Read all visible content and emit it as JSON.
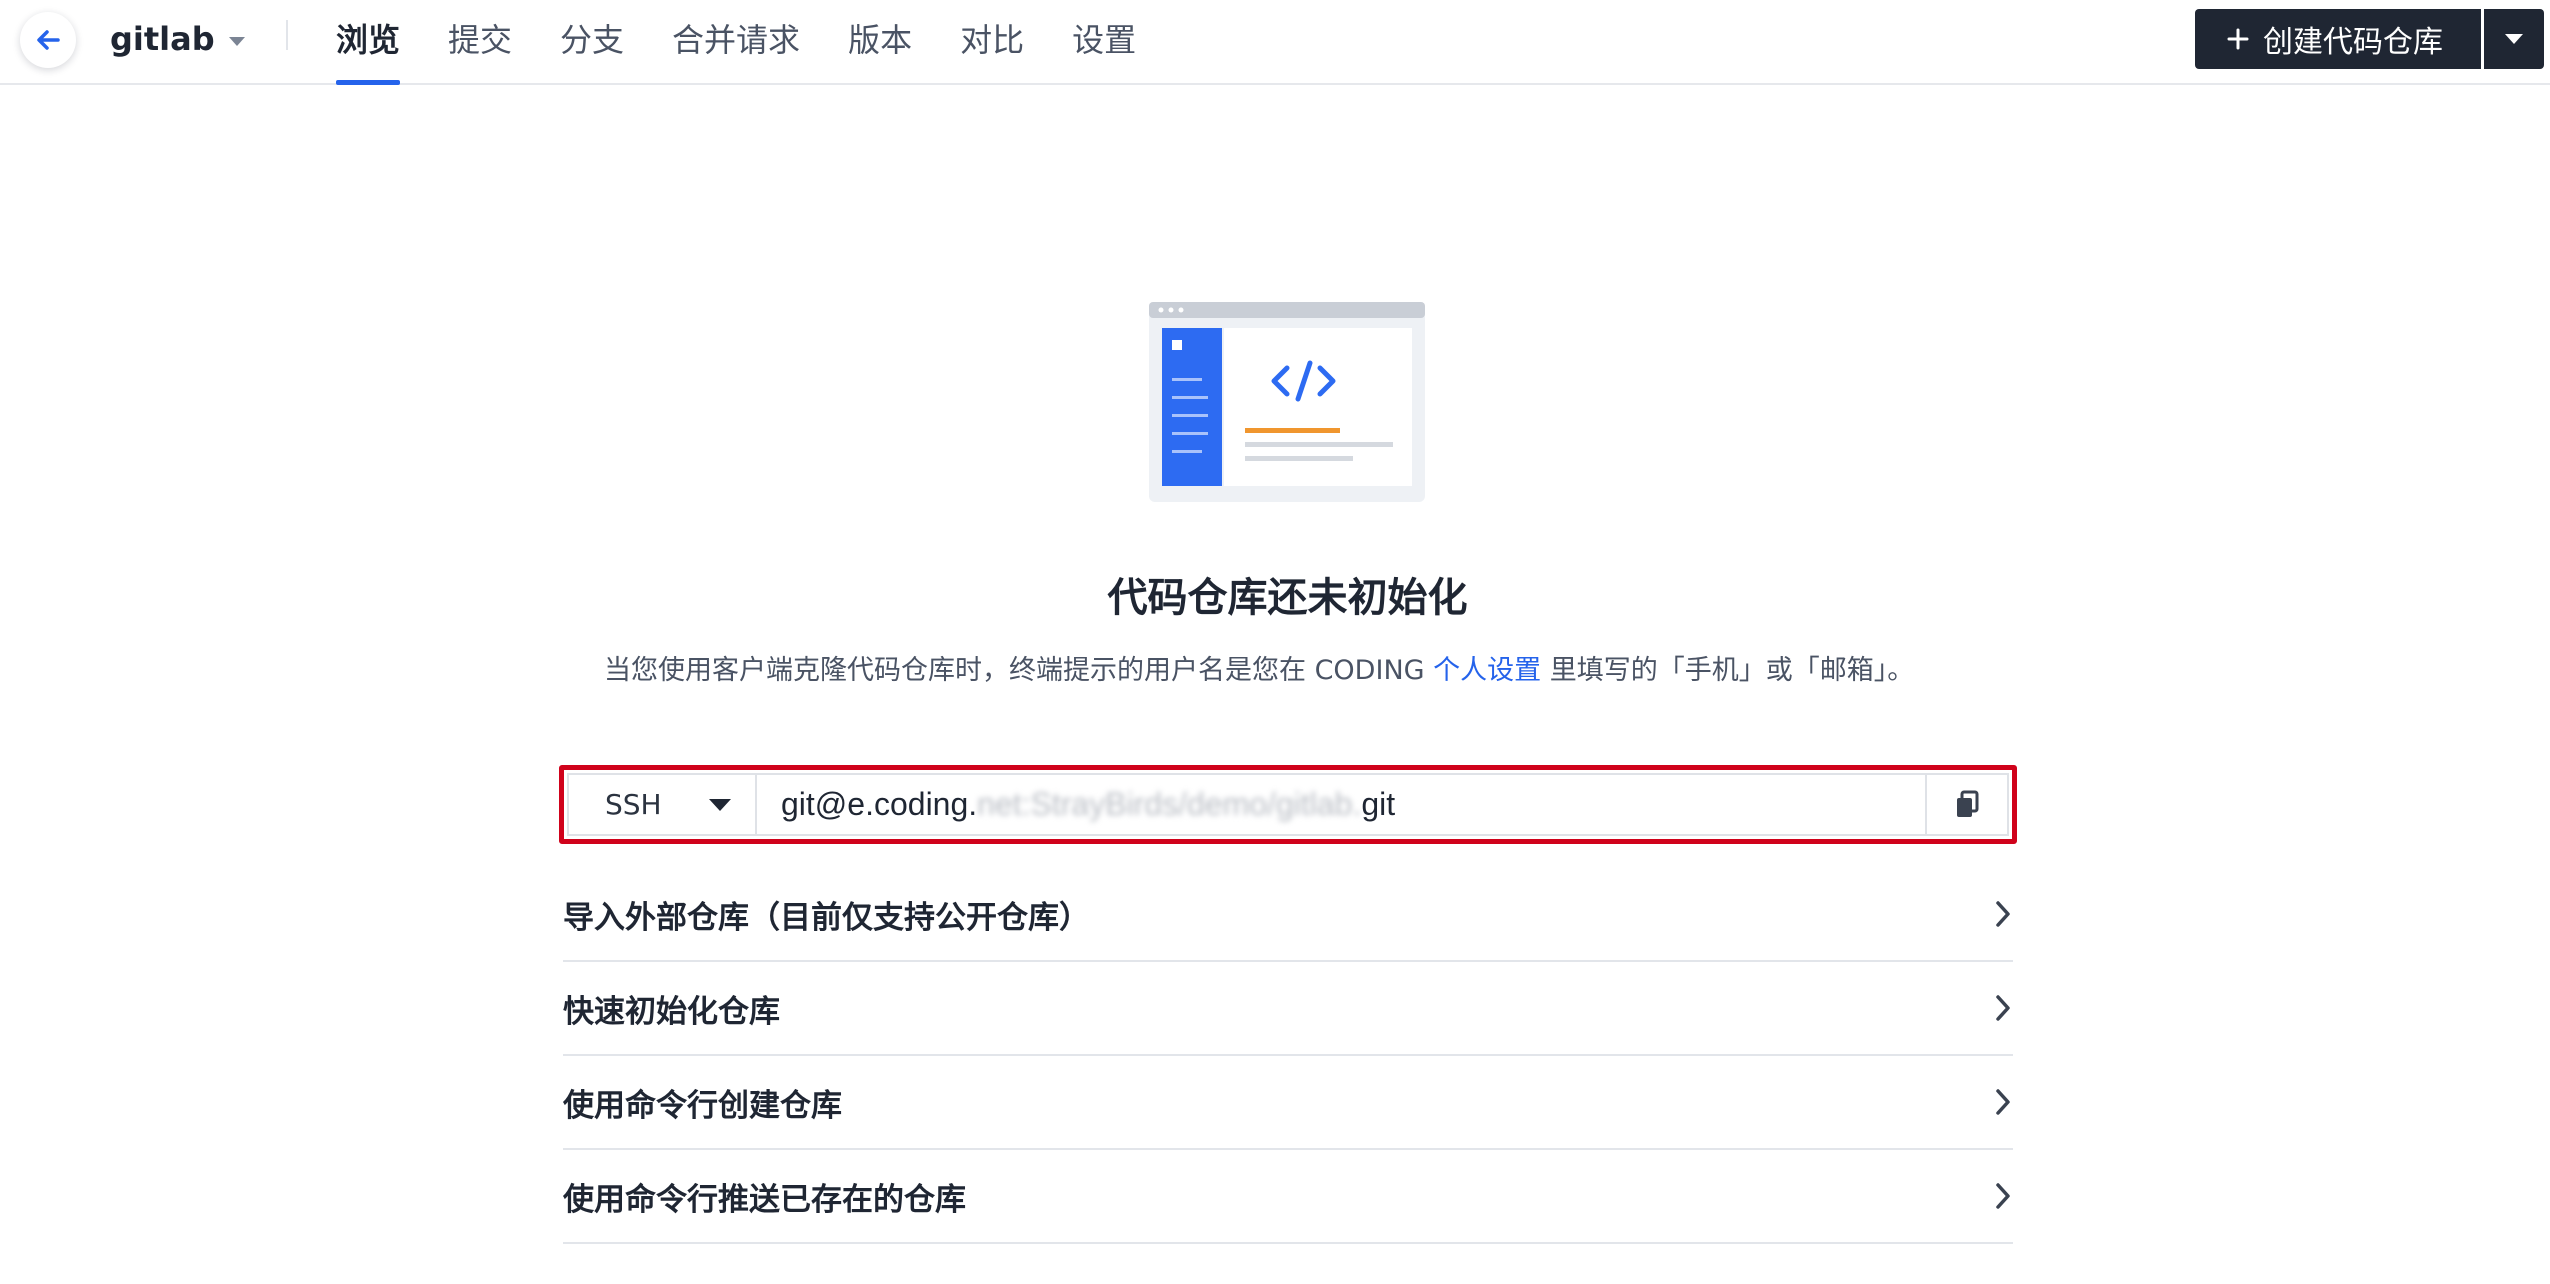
{
  "header": {
    "repo_name": "gitlab",
    "tabs": [
      {
        "label": "浏览",
        "active": true
      },
      {
        "label": "提交"
      },
      {
        "label": "分支"
      },
      {
        "label": "合并请求"
      },
      {
        "label": "版本"
      },
      {
        "label": "对比"
      },
      {
        "label": "设置"
      }
    ],
    "create_button_label": "创建代码仓库",
    "icons": {
      "back": "back-arrow-icon",
      "dropdown": "chevron-down-icon",
      "plus": "plus-icon"
    }
  },
  "empty_state": {
    "title": "代码仓库还未初始化",
    "description_before": "当您使用客户端克隆代码仓库时，终端提示的用户名是您在 CODING ",
    "description_link": "个人设置",
    "description_after": " 里填写的「手机」或「邮箱」。"
  },
  "clone": {
    "protocol": "SSH",
    "url_prefix": "git@e.coding.",
    "url_redacted": "net:StrayBirds/demo/gitlab.",
    "url_suffix": "git",
    "copy_icon": "copy-icon"
  },
  "options": [
    {
      "label": "导入外部仓库（目前仅支持公开仓库）"
    },
    {
      "label": "快速初始化仓库"
    },
    {
      "label": "使用命令行创建仓库"
    },
    {
      "label": "使用命令行推送已存在的仓库"
    }
  ],
  "colors": {
    "accent": "#2563eb",
    "dark": "#1f2633",
    "highlight": "#d0021b",
    "illustration_orange": "#f0962e"
  }
}
